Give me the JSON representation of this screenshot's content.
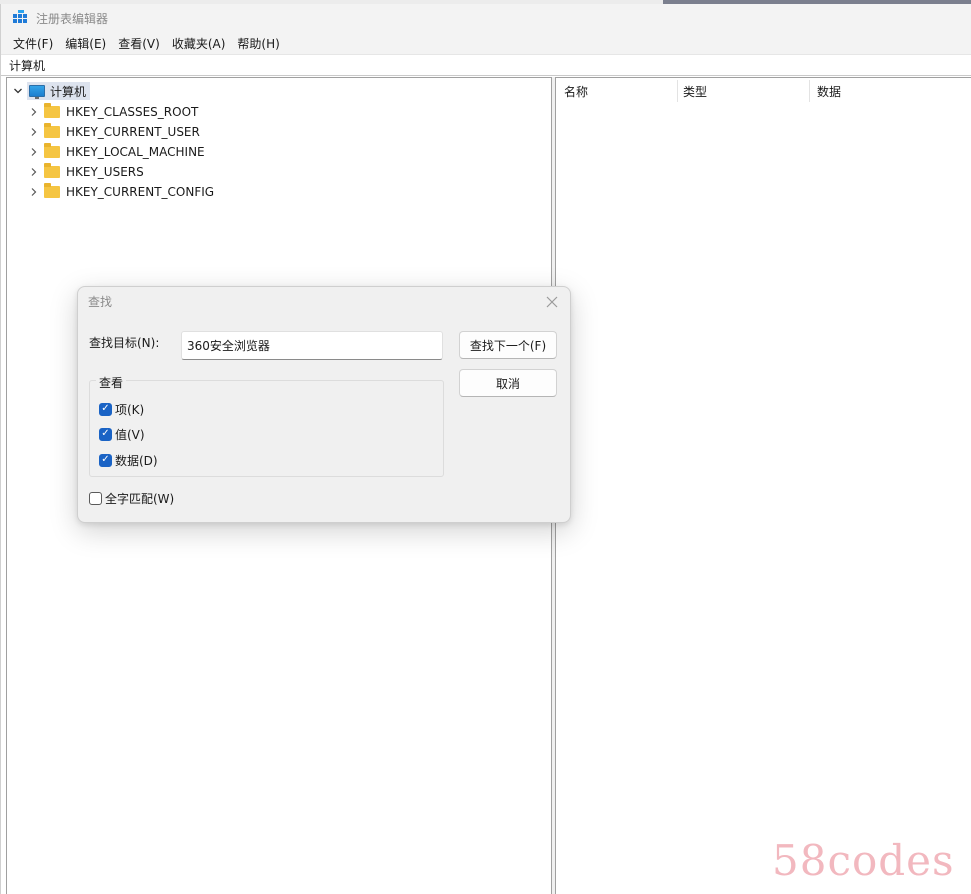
{
  "window": {
    "title": "注册表编辑器"
  },
  "menu": [
    {
      "label": "文件(F)"
    },
    {
      "label": "编辑(E)"
    },
    {
      "label": "查看(V)"
    },
    {
      "label": "收藏夹(A)"
    },
    {
      "label": "帮助(H)"
    }
  ],
  "address": {
    "path": "计算机"
  },
  "tree": {
    "root_label": "计算机",
    "items": [
      {
        "label": "HKEY_CLASSES_ROOT"
      },
      {
        "label": "HKEY_CURRENT_USER"
      },
      {
        "label": "HKEY_LOCAL_MACHINE"
      },
      {
        "label": "HKEY_USERS"
      },
      {
        "label": "HKEY_CURRENT_CONFIG"
      }
    ]
  },
  "list": {
    "columns": [
      {
        "label": "名称"
      },
      {
        "label": "类型"
      },
      {
        "label": "数据"
      }
    ]
  },
  "find_dialog": {
    "title": "查找",
    "target_label": "查找目标(N):",
    "target_value": "360安全浏览器",
    "find_next_label": "查找下一个(F)",
    "cancel_label": "取消",
    "look_at": {
      "title": "查看",
      "options": [
        {
          "label": "项(K)",
          "checked": true
        },
        {
          "label": "值(V)",
          "checked": true
        },
        {
          "label": "数据(D)",
          "checked": true
        }
      ]
    },
    "match_whole": {
      "label": "全字匹配(W)",
      "checked": false
    }
  },
  "watermark": "58codes",
  "colors": {
    "accent": "#1a63c5",
    "folder": "#f5c542",
    "selection": "#dde3ee"
  }
}
